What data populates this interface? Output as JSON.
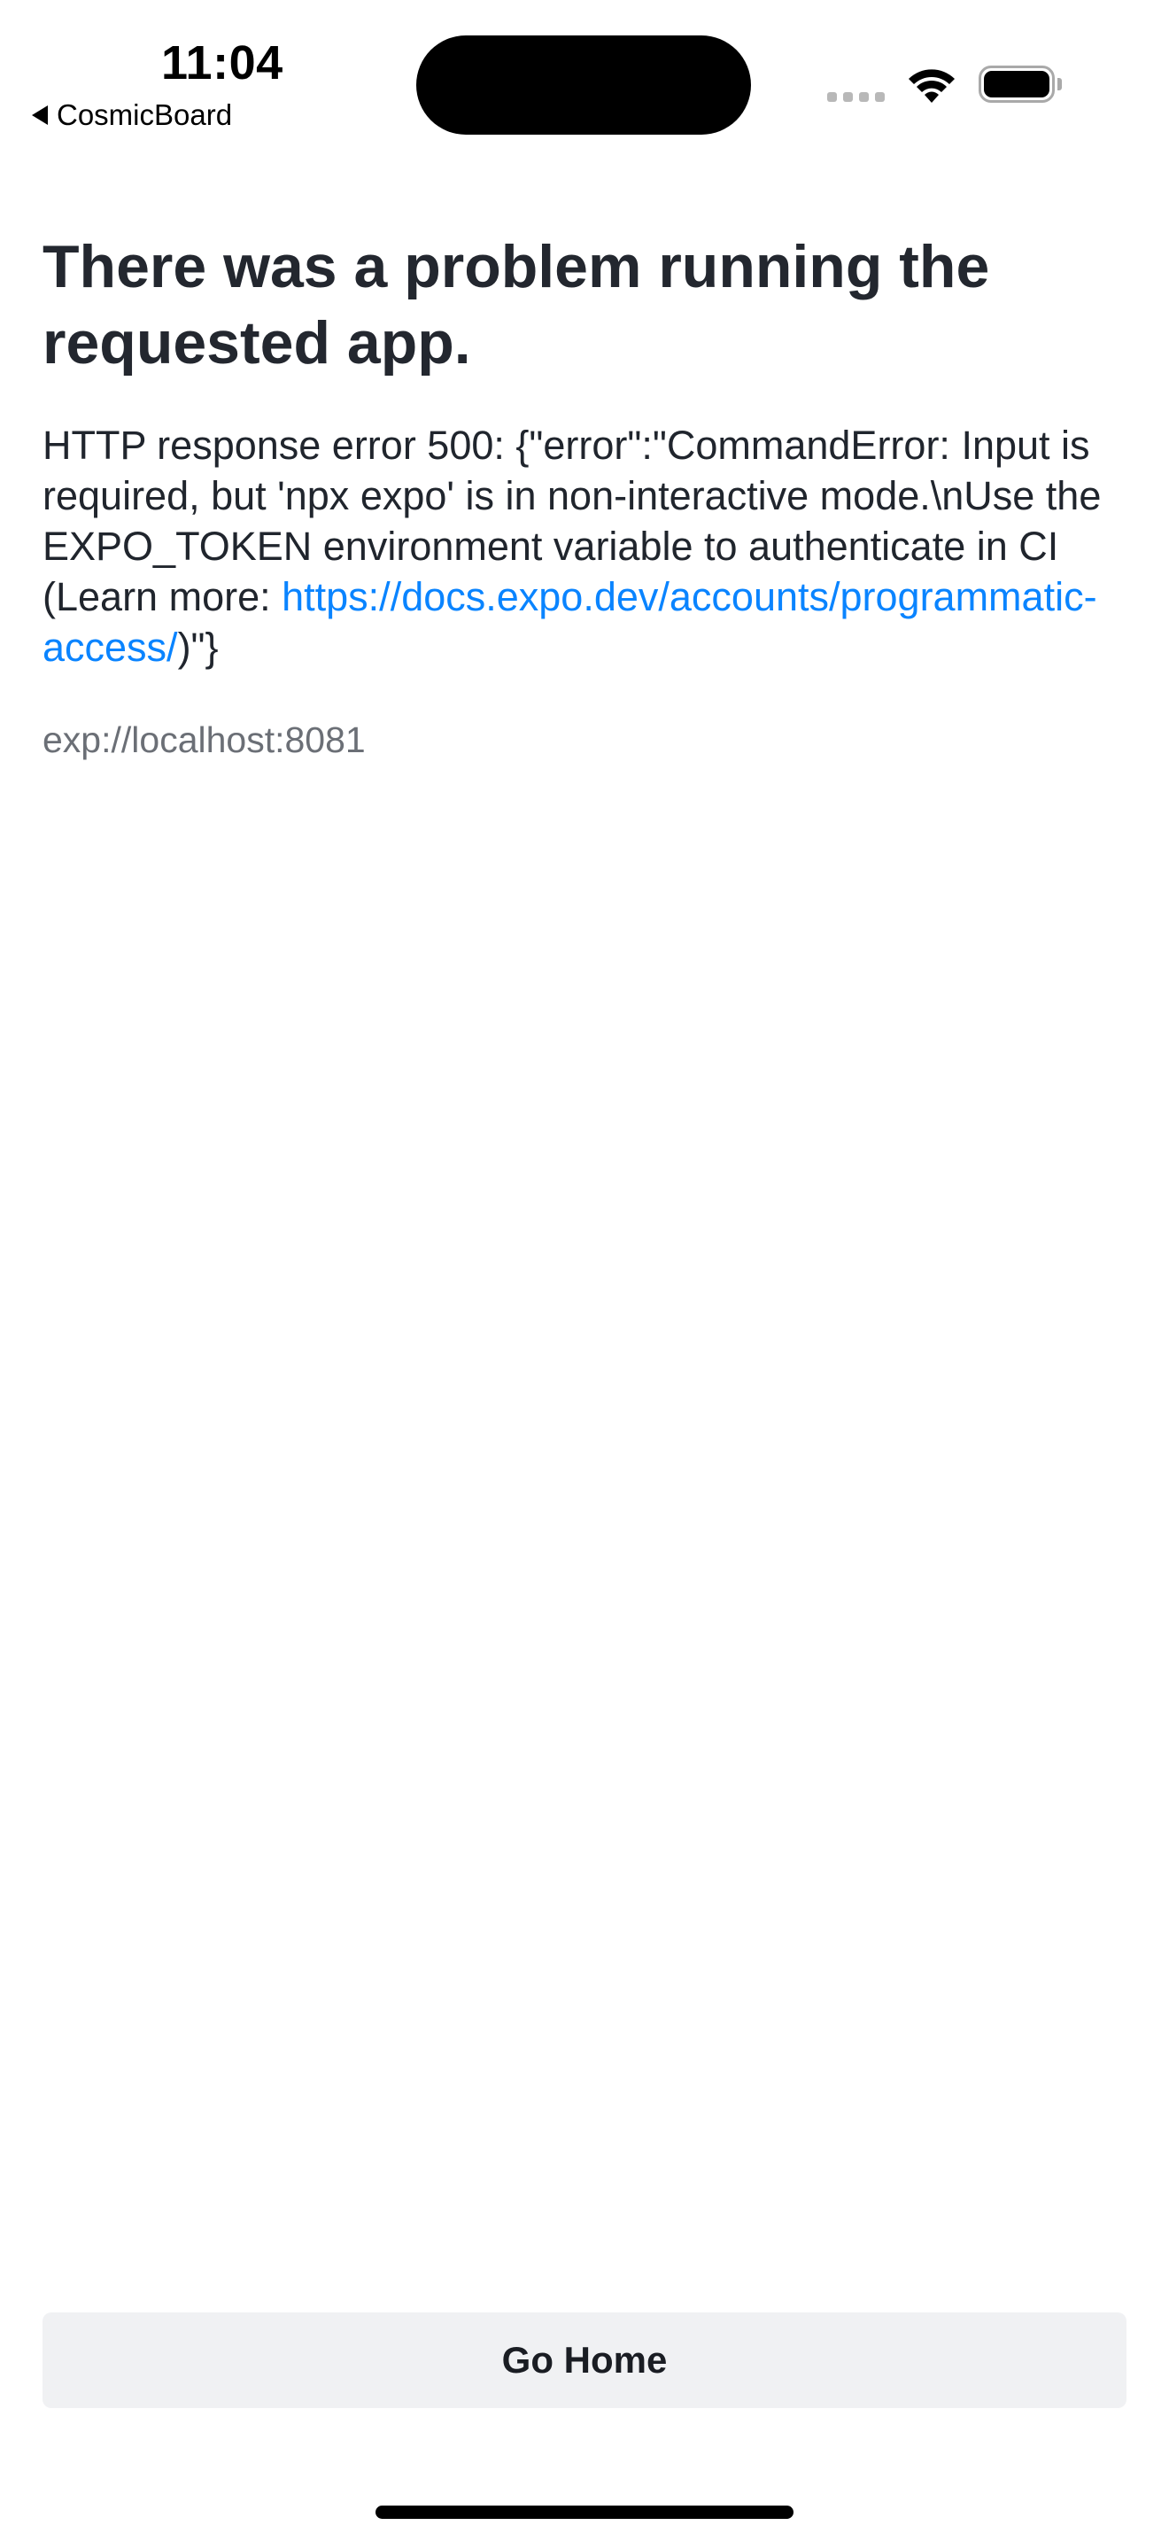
{
  "status_bar": {
    "time": "11:04",
    "back_app": "CosmicBoard"
  },
  "error": {
    "title": "There was a problem running the requested app.",
    "message_prefix": "HTTP response error 500: {\"error\":\"CommandError: Input is required, but 'npx expo' is in non-interactive mode.\\nUse the EXPO_TOKEN environment variable to authenticate in CI (Learn more: ",
    "link_text": "https://docs.expo.dev/accounts/programmatic-access/",
    "message_suffix": ")\"}",
    "url": "exp://localhost:8081"
  },
  "actions": {
    "go_home_label": "Go Home"
  },
  "colors": {
    "link": "#0a84ff",
    "button_bg": "#f0f1f3",
    "title": "#23272f",
    "secondary_text": "#6b6f76"
  },
  "icons": [
    "back-arrow-icon",
    "cellular-signal-icon",
    "wifi-icon",
    "battery-icon"
  ]
}
